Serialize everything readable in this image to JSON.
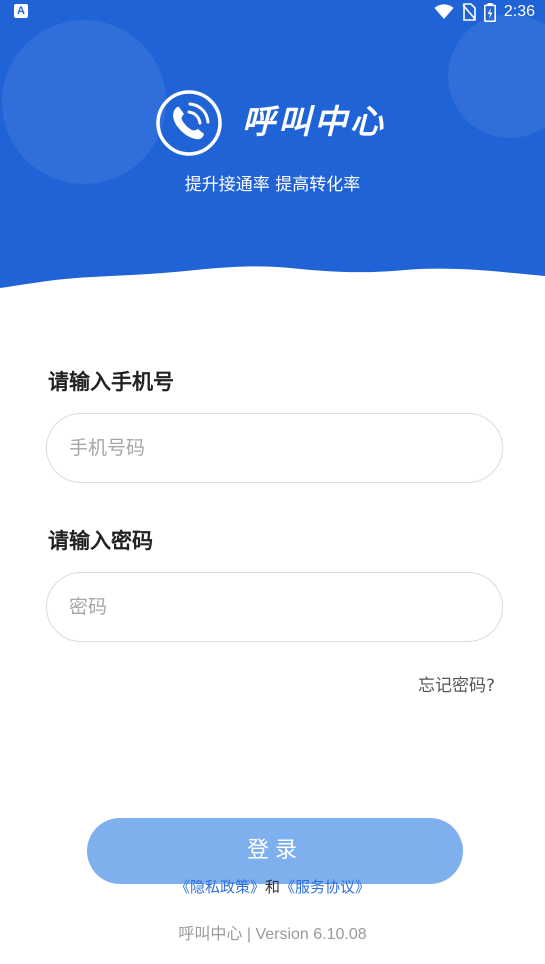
{
  "colors": {
    "header_blue": "#1f63d6",
    "button_disabled": "#7fb0ee",
    "link_blue": "#2f72dc",
    "label_text": "#222222",
    "placeholder_text": "#a6a6a6",
    "footer_text": "#9a9a9a"
  },
  "status_bar": {
    "app_icon": "A",
    "icons": [
      "wifi-icon",
      "no-sim-icon",
      "battery-charging-icon"
    ],
    "time": "2:36"
  },
  "brand": {
    "logo_icon": "phone-call-icon",
    "name": "呼叫中心",
    "slogan": "提升接通率 提高转化率"
  },
  "form": {
    "phone_label": "请输入手机号",
    "phone_placeholder": "手机号码",
    "phone_value": "",
    "password_label": "请输入密码",
    "password_placeholder": "密码",
    "password_value": "",
    "forgot_password": "忘记密码?"
  },
  "login_button": "登录",
  "agreement": {
    "privacy_link": "《隐私政策》",
    "joiner": "和",
    "service_link": "《服务协议》"
  },
  "footer": {
    "app_name": "呼叫中心",
    "separator": "|",
    "version": "Version 6.10.08"
  }
}
